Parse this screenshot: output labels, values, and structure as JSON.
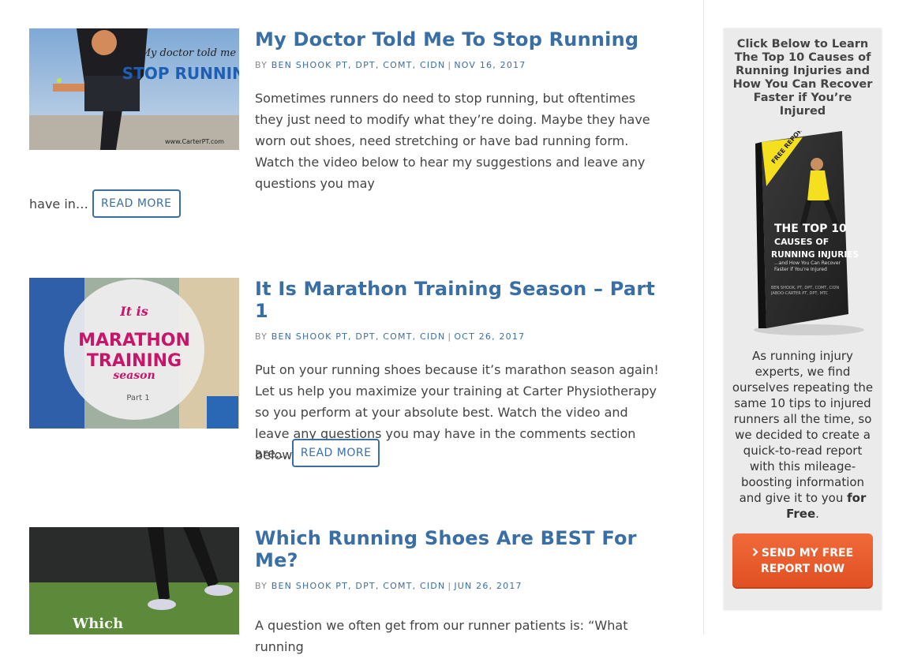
{
  "posts": [
    {
      "title": "My Doctor Told Me To Stop Running",
      "by": "BY",
      "author": "BEN SHOOK PT, DPT, COMT, CIDN",
      "date": "NOV 16, 2017",
      "excerpt": "Sometimes runners do need to stop running, but oftentimes they just need to modify what they’re doing. Maybe they have worn out shoes, need stretching or have bad running form. Watch the video below to hear my suggestions and leave any questions you may",
      "excerpt_tail": "have in…",
      "read_more": "READ MORE",
      "thumb": {
        "line1": "My doctor told me to",
        "line2": "STOP RUNNING",
        "url": "www.CarterPT.com"
      }
    },
    {
      "title": "It Is Marathon Training Season – Part 1",
      "by": "BY",
      "author": "BEN SHOOK PT, DPT, COMT, CIDN",
      "date": "OCT 26, 2017",
      "excerpt": "Put on your running shoes because it’s marathon season again! Let us help you maximize your training at Carter Physiotherapy so you perform at your absolute best. Watch the video and leave any questions you may have in the comments section below.   If you",
      "excerpt_tail": "are…",
      "read_more": "READ MORE",
      "thumb": {
        "line1": "It is",
        "line2": "MARATHON",
        "line3": "TRAINING",
        "line4": "season",
        "line5": "Part 1"
      }
    },
    {
      "title": "Which Running Shoes Are BEST For Me?",
      "by": "BY",
      "author": "BEN SHOOK PT, DPT, COMT, CIDN",
      "date": "JUN 26, 2017",
      "excerpt": "A question we often get from our runner patients is: “What running",
      "thumb": {
        "line1": "Which"
      }
    }
  ],
  "sidebar": {
    "heading": "Click Below to Learn The Top 10 Causes of Running Injuries and How You Can Recover Faster if You’re Injured",
    "book": {
      "badge": "FREE REPORT",
      "title1": "THE TOP 10",
      "title2": "CAUSES OF",
      "title3": "RUNNING INJURIES",
      "subtitle": "...and How You Can Recover Faster if You’re Injured",
      "authors": "BEN SHOOK, PT, DPT, COMT, CIDN JABOO-CARTER PT, DPT, MTC"
    },
    "body_text": "As running injury experts, we find ourselves repeating the same 10 tips to injured runners all the time, so we decided to create a quick-to-read report with this mileage-boosting information and give it to you",
    "body_bold": "for Free",
    "body_end": ".",
    "cta_label": "SEND MY FREE REPORT NOW",
    "cta_icon": "chevron-right-icon"
  }
}
